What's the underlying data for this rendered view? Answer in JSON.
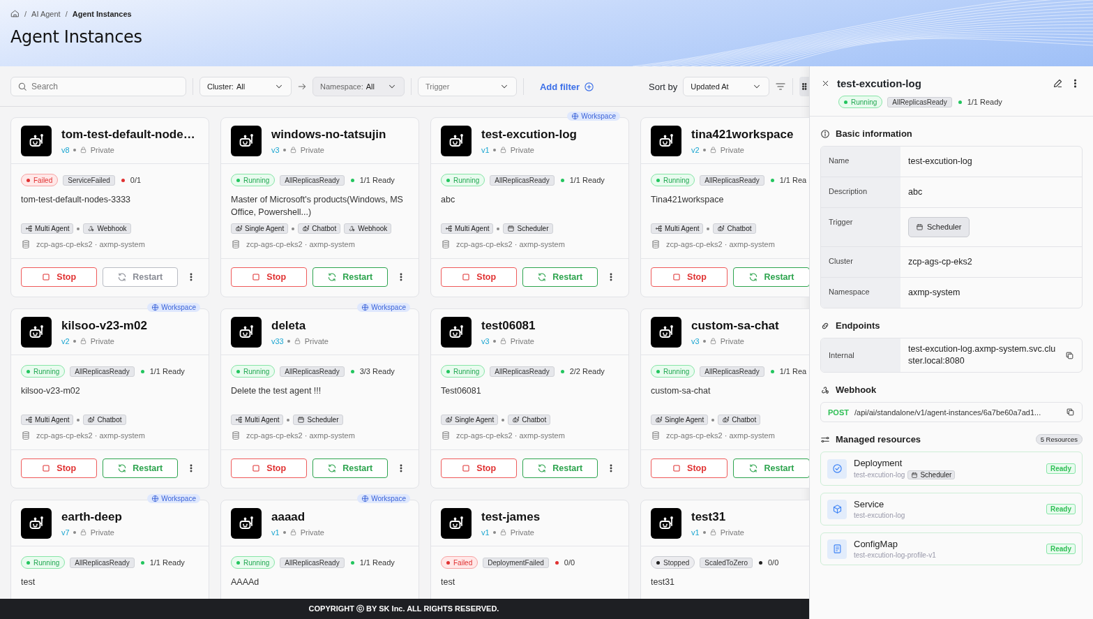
{
  "breadcrumb": [
    {
      "label": "AI Agent",
      "separator": "/",
      "current": false
    },
    {
      "label": "Agent Instances",
      "separator": "/",
      "current": true
    }
  ],
  "page_title": "Agent Instances",
  "filters": {
    "search": {
      "placeholder": "Search"
    },
    "cluster": {
      "label": "Cluster:",
      "value": "All",
      "disabled": false
    },
    "namespace": {
      "label": "Namespace:",
      "value": "All",
      "disabled": true
    },
    "trigger": {
      "placeholder": "Trigger"
    },
    "add_filter": "Add filter",
    "sort_label": "Sort by",
    "sort_value": "Updated At"
  },
  "cards": [
    {
      "name": "tom-test-default-node…",
      "version": "v8",
      "visibility": "Private",
      "status": {
        "label": "Failed",
        "kind": "failed"
      },
      "reason": "ServiceFailed",
      "ready": "0/1",
      "description": "tom-test-default-nodes-3333",
      "more_menu": true,
      "agent_type": {
        "label": "Multi Agent",
        "kind": "multi"
      },
      "triggers": [
        {
          "label": "Webhook",
          "kind": "webhook"
        }
      ],
      "location": "zcp-ags-cp-eks2 · axmp-system",
      "stop_label": "Stop",
      "restart_label": "Restart",
      "restart_disabled": true
    },
    {
      "name": "windows-no-tatsujin",
      "version": "v3",
      "visibility": "Private",
      "status": {
        "label": "Running",
        "kind": "running"
      },
      "reason": "AllReplicasReady",
      "ready": "1/1 Ready",
      "description": "Master of Microsoft's products(Windows, MS Office, Powershell...)",
      "more_menu": true,
      "agent_type": {
        "label": "Single Agent",
        "kind": "single"
      },
      "triggers": [
        {
          "label": "Chatbot",
          "kind": "chatbot"
        },
        {
          "label": "Webhook",
          "kind": "webhook"
        }
      ],
      "location": "zcp-ags-cp-eks2 · axmp-system",
      "stop_label": "Stop",
      "restart_label": "Restart",
      "restart_disabled": false
    },
    {
      "badge": "Workspace",
      "name": "test-excution-log",
      "version": "v1",
      "visibility": "Private",
      "status": {
        "label": "Running",
        "kind": "running"
      },
      "reason": "AllReplicasReady",
      "ready": "1/1 Ready",
      "description": "abc",
      "more_menu": true,
      "agent_type": {
        "label": "Multi Agent",
        "kind": "multi"
      },
      "triggers": [
        {
          "label": "Scheduler",
          "kind": "scheduler"
        }
      ],
      "location": "zcp-ags-cp-eks2 · axmp-system",
      "stop_label": "Stop",
      "restart_label": "Restart",
      "restart_disabled": false
    },
    {
      "name": "tina421workspace",
      "version": "v2",
      "visibility": "Private",
      "status": {
        "label": "Running",
        "kind": "running"
      },
      "reason": "AllReplicasReady",
      "ready": "1/1 Rea",
      "description": "Tina421workspace",
      "agent_type": {
        "label": "Multi Agent",
        "kind": "multi"
      },
      "triggers": [
        {
          "label": "Chatbot",
          "kind": "chatbot"
        }
      ],
      "location": "zcp-ags-cp-eks2 · axmp-system",
      "stop_label": "Stop",
      "restart_label": "Restart",
      "restart_disabled": false
    },
    {
      "badge": "Workspace",
      "name": "kilsoo-v23-m02",
      "version": "v2",
      "visibility": "Private",
      "status": {
        "label": "Running",
        "kind": "running"
      },
      "reason": "AllReplicasReady",
      "ready": "1/1 Ready",
      "description": "kilsoo-v23-m02",
      "more_menu": true,
      "agent_type": {
        "label": "Multi Agent",
        "kind": "multi"
      },
      "triggers": [
        {
          "label": "Chatbot",
          "kind": "chatbot"
        }
      ],
      "location": "zcp-ags-cp-eks2 · axmp-system",
      "stop_label": "Stop",
      "restart_label": "Restart",
      "restart_disabled": false
    },
    {
      "badge": "Workspace",
      "name": "deleta",
      "version": "v33",
      "visibility": "Private",
      "status": {
        "label": "Running",
        "kind": "running"
      },
      "reason": "AllReplicasReady",
      "ready": "3/3 Ready",
      "description": "Delete the test agent !!!",
      "more_menu": true,
      "agent_type": {
        "label": "Multi Agent",
        "kind": "multi"
      },
      "triggers": [
        {
          "label": "Scheduler",
          "kind": "scheduler"
        }
      ],
      "location": "zcp-ags-cp-eks2 · axmp-system",
      "stop_label": "Stop",
      "restart_label": "Restart",
      "restart_disabled": false
    },
    {
      "name": "test06081",
      "version": "v3",
      "visibility": "Private",
      "status": {
        "label": "Running",
        "kind": "running"
      },
      "reason": "AllReplicasReady",
      "ready": "2/2 Ready",
      "description": "Test06081",
      "more_menu": true,
      "agent_type": {
        "label": "Single Agent",
        "kind": "single"
      },
      "triggers": [
        {
          "label": "Chatbot",
          "kind": "chatbot"
        }
      ],
      "location": "zcp-ags-cp-eks2 · axmp-system",
      "stop_label": "Stop",
      "restart_label": "Restart",
      "restart_disabled": false
    },
    {
      "name": "custom-sa-chat",
      "version": "v3",
      "visibility": "Private",
      "status": {
        "label": "Running",
        "kind": "running"
      },
      "reason": "AllReplicasReady",
      "ready": "1/1 Rea",
      "description": "custom-sa-chat",
      "agent_type": {
        "label": "Single Agent",
        "kind": "single"
      },
      "triggers": [
        {
          "label": "Chatbot",
          "kind": "chatbot"
        }
      ],
      "location": "zcp-ags-cp-eks2 · axmp-system",
      "stop_label": "Stop",
      "restart_label": "Restart",
      "restart_disabled": false
    },
    {
      "badge": "Workspace",
      "name": "earth-deep",
      "version": "v7",
      "visibility": "Private",
      "status": {
        "label": "Running",
        "kind": "running"
      },
      "reason": "AllReplicasReady",
      "ready": "1/1 Ready",
      "description": "test"
    },
    {
      "badge": "Workspace",
      "name": "aaaad",
      "version": "v1",
      "visibility": "Private",
      "status": {
        "label": "Running",
        "kind": "running"
      },
      "reason": "AllReplicasReady",
      "ready": "1/1 Ready",
      "description": "AAAAd"
    },
    {
      "name": "test-james",
      "version": "v1",
      "visibility": "Private",
      "status": {
        "label": "Failed",
        "kind": "failed"
      },
      "reason": "DeploymentFailed",
      "ready": "0/0",
      "description": "test"
    },
    {
      "name": "test31",
      "version": "v1",
      "visibility": "Private",
      "status": {
        "label": "Stopped",
        "kind": "stopped"
      },
      "reason": "ScaledToZero",
      "ready": "0/0",
      "description": "test31"
    }
  ],
  "detail": {
    "title": "test-excution-log",
    "status": {
      "label": "Running",
      "kind": "running"
    },
    "reason": "AllReplicasReady",
    "ready": "1/1 Ready",
    "basic_title": "Basic information",
    "basic": [
      {
        "label": "Name",
        "value": "test-excution-log"
      },
      {
        "label": "Description",
        "value": "abc"
      },
      {
        "label": "Trigger",
        "value": "Scheduler",
        "kind": "tag"
      },
      {
        "label": "Cluster",
        "value": "zcp-ags-cp-eks2"
      },
      {
        "label": "Namespace",
        "value": "axmp-system"
      }
    ],
    "endpoints_title": "Endpoints",
    "endpoints": [
      {
        "label": "Internal",
        "value": "test-excution-log.axmp-system.svc.cluster.local:8080"
      }
    ],
    "webhook_title": "Webhook",
    "webhook": {
      "method": "POST",
      "url": "/api/ai/standalone/v1/agent-instances/6a7be60a7ad1..."
    },
    "resources_title": "Managed resources",
    "resources_count": "5 Resources",
    "resources": [
      {
        "type": "Deployment",
        "kind": "deployment",
        "name": "test-excution-log",
        "tag": "Scheduler",
        "status": "Ready"
      },
      {
        "type": "Service",
        "kind": "service",
        "name": "test-excution-log",
        "status": "Ready"
      },
      {
        "type": "ConfigMap",
        "kind": "configmap",
        "name": "test-excution-log-profile-v1",
        "status": "Ready"
      }
    ]
  },
  "footer": "COPYRIGHT ⓒ BY SK Inc. ALL RIGHTS RESERVED."
}
